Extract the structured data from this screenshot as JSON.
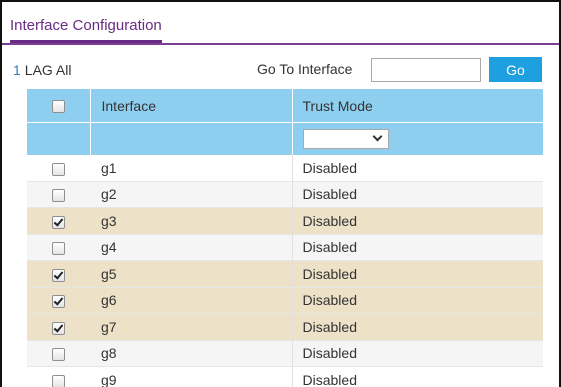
{
  "page": {
    "title": "Interface Configuration"
  },
  "toolbar": {
    "lag_count": "1",
    "lag_label": "LAG All",
    "goto_label": "Go To Interface",
    "goto_value": "",
    "go_label": "Go"
  },
  "table": {
    "columns": [
      "",
      "Interface",
      "Trust Mode"
    ],
    "filter": {
      "trust_mode_selected": ""
    },
    "rows": [
      {
        "interface": "g1",
        "trust_mode": "Disabled",
        "checked": false
      },
      {
        "interface": "g2",
        "trust_mode": "Disabled",
        "checked": false
      },
      {
        "interface": "g3",
        "trust_mode": "Disabled",
        "checked": true
      },
      {
        "interface": "g4",
        "trust_mode": "Disabled",
        "checked": false
      },
      {
        "interface": "g5",
        "trust_mode": "Disabled",
        "checked": true
      },
      {
        "interface": "g6",
        "trust_mode": "Disabled",
        "checked": true
      },
      {
        "interface": "g7",
        "trust_mode": "Disabled",
        "checked": true
      },
      {
        "interface": "g8",
        "trust_mode": "Disabled",
        "checked": false
      },
      {
        "interface": "g9",
        "trust_mode": "Disabled",
        "checked": false
      }
    ]
  },
  "colors": {
    "accent_purple": "#6a2c82",
    "header_blue": "#8ecfef",
    "button_blue": "#1d9fe0",
    "selected_row": "#ede1c8",
    "alt_row": "#f5f5f5"
  },
  "icons": {
    "filter_select": "chevron-down-icon"
  }
}
